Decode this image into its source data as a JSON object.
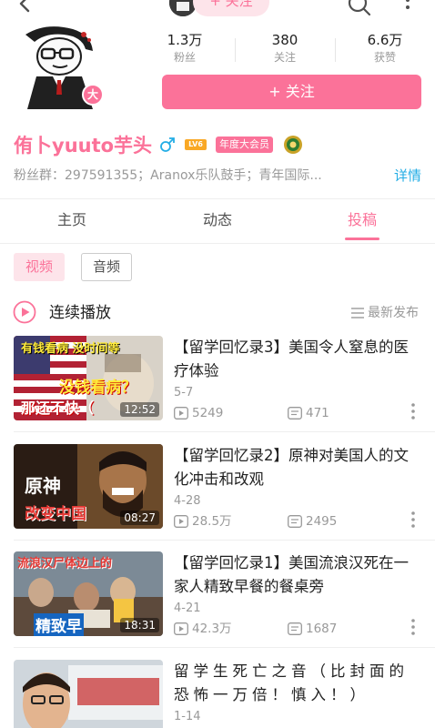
{
  "top_bar": {
    "follow_label": "+ 关注"
  },
  "profile": {
    "avatar_badge": "大",
    "stats": [
      {
        "value": "1.3万",
        "label": "粉丝"
      },
      {
        "value": "380",
        "label": "关注"
      },
      {
        "value": "6.6万",
        "label": "获赞"
      }
    ],
    "follow_button": "+ 关注",
    "username": "侑卜yuuto芋头",
    "level": "LV6",
    "vip_badge": "年度大会员",
    "bio": "粉丝群：297591355；Aranox乐队鼓手；青年国际...",
    "detail_link": "详情"
  },
  "tabs": [
    {
      "label": "主页",
      "active": false
    },
    {
      "label": "动态",
      "active": false
    },
    {
      "label": "投稿",
      "active": true
    }
  ],
  "filters": [
    {
      "label": "视频",
      "active": true
    },
    {
      "label": "音频",
      "active": false
    }
  ],
  "playlist": {
    "label": "连续播放",
    "sort_label": "最新发布"
  },
  "videos": [
    {
      "title": "【留学回忆录3】美国令人窒息的医疗体验",
      "date": "5-7",
      "plays": "5249",
      "danmaku": "471",
      "duration": "12:52",
      "thumb_top": "有钱看病 没时间等",
      "thumb_mid": "没钱看病？",
      "thumb_bottom": "那还不快（"
    },
    {
      "title": "【留学回忆录2】原神对美国人的文化冲击和改观",
      "date": "4-28",
      "plays": "28.5万",
      "danmaku": "2495",
      "duration": "08:27",
      "thumb_top": "原神",
      "thumb_mid": "改变中国",
      "thumb_bottom": ""
    },
    {
      "title": "【留学回忆录1】美国流浪汉死在一家人精致早餐的餐桌旁",
      "date": "4-21",
      "plays": "42.3万",
      "danmaku": "1687",
      "duration": "18:31",
      "thumb_top": "流浪汉尸体边上的",
      "thumb_mid": "精致早",
      "thumb_bottom": ""
    },
    {
      "title": "留学生死亡之音（比封面的恐怖一万倍！慎入！）",
      "date": "1-14",
      "plays": "",
      "danmaku": "",
      "duration": "",
      "thumb_top": "",
      "thumb_mid": "",
      "thumb_bottom": ""
    }
  ],
  "colors": {
    "accent": "#fb7299",
    "accent_light": "#fde4ea",
    "link": "#23ade5",
    "muted": "#999999"
  }
}
